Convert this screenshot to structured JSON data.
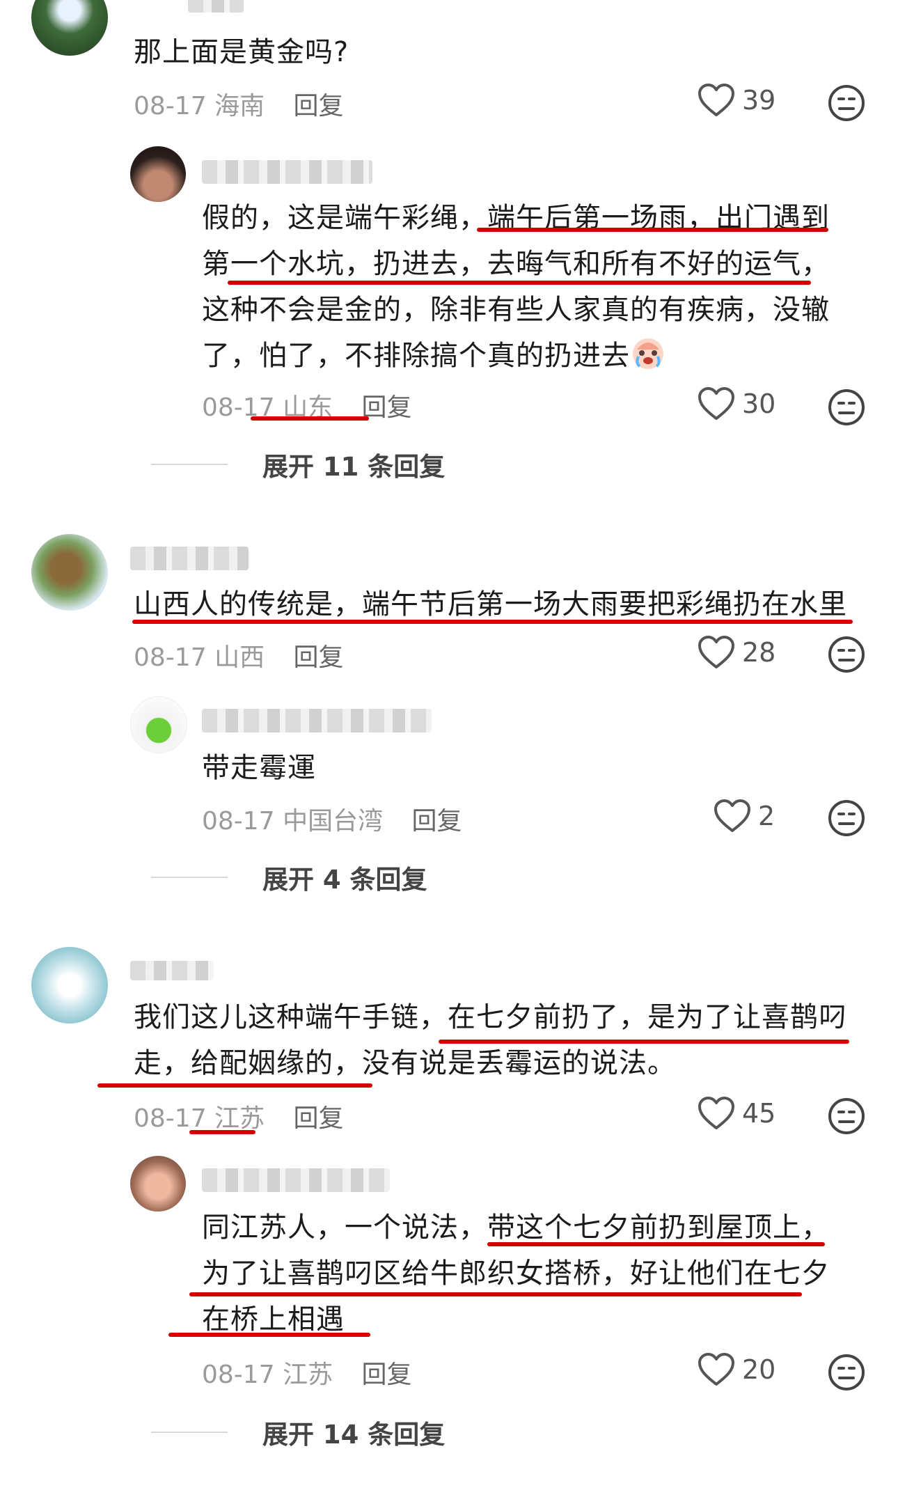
{
  "comments": [
    {
      "text": "那上面是黄金吗?",
      "date": "08-17",
      "location": "海南",
      "reply_label": "回复",
      "likes": "39",
      "replies": [
        {
          "lines": [
            "假的，这是端午彩绳，端午后第一场雨，出门遇到",
            "第一个水坑，扔进去，去晦气和所有不好的运气，",
            "这种不会是金的，除非有些人家真的有疾病，没辙",
            "了，怕了，不排除搞个真的扔进去"
          ],
          "date": "08-17",
          "location": "山东",
          "reply_label": "回复",
          "likes": "30"
        }
      ],
      "expand_label": "展开 11 条回复"
    },
    {
      "text": "山西人的传统是，端午节后第一场大雨要把彩绳扔在水里",
      "date": "08-17",
      "location": "山西",
      "reply_label": "回复",
      "likes": "28",
      "replies": [
        {
          "lines": [
            "带走霉運"
          ],
          "date": "08-17",
          "location": "中国台湾",
          "reply_label": "回复",
          "likes": "2"
        }
      ],
      "expand_label": "展开 4 条回复"
    },
    {
      "lines": [
        "我们这儿这种端午手链，在七夕前扔了，是为了让喜鹊叼",
        "走，给配姻缘的，没有说是丢霉运的说法。"
      ],
      "date": "08-17",
      "location": "江苏",
      "reply_label": "回复",
      "likes": "45",
      "replies": [
        {
          "lines": [
            "同江苏人，一个说法，带这个七夕前扔到屋顶上，",
            "为了让喜鹊叼区给牛郎织女搭桥，好让他们在七夕",
            "在桥上相遇"
          ],
          "date": "08-17",
          "location": "江苏",
          "reply_label": "回复",
          "likes": "20"
        }
      ],
      "expand_label": "展开 14 条回复"
    }
  ],
  "colors": {
    "underline": "#d40000",
    "meta": "#9a9a9a"
  },
  "icons": {
    "like": "heart-outline-icon",
    "react": "neutral-face-icon"
  }
}
